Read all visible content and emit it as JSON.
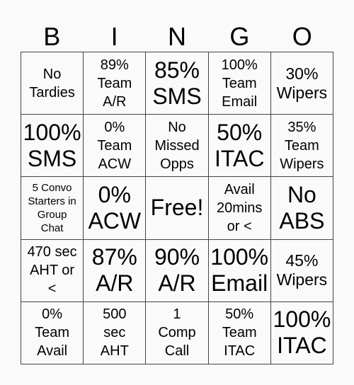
{
  "header": [
    "B",
    "I",
    "N",
    "G",
    "O"
  ],
  "cells": [
    {
      "text": "No\nTardies",
      "size": "m"
    },
    {
      "text": "89%\nTeam\nA/R",
      "size": "m"
    },
    {
      "text": "85%\nSMS",
      "size": "xl"
    },
    {
      "text": "100%\nTeam\nEmail",
      "size": "m"
    },
    {
      "text": "30%\nWipers",
      "size": "l"
    },
    {
      "text": "100%\nSMS",
      "size": "xl"
    },
    {
      "text": "0%\nTeam\nACW",
      "size": "m"
    },
    {
      "text": "No\nMissed\nOpps",
      "size": "m"
    },
    {
      "text": "50%\nITAC",
      "size": "xl"
    },
    {
      "text": "35%\nTeam\nWipers",
      "size": "m"
    },
    {
      "text": "5 Convo\nStarters in\nGroup\nChat",
      "size": "s"
    },
    {
      "text": "0%\nACW",
      "size": "xl"
    },
    {
      "text": "Free!",
      "size": "xl"
    },
    {
      "text": "Avail\n20mins\nor <",
      "size": "m"
    },
    {
      "text": "No\nABS",
      "size": "xl"
    },
    {
      "text": "470 sec\nAHT or\n<",
      "size": "m"
    },
    {
      "text": "87%\nA/R",
      "size": "xl"
    },
    {
      "text": "90%\nA/R",
      "size": "xl"
    },
    {
      "text": "100%\nEmail",
      "size": "xl"
    },
    {
      "text": "45%\nWipers",
      "size": "l"
    },
    {
      "text": "0%\nTeam\nAvail",
      "size": "m"
    },
    {
      "text": "500\nsec\nAHT",
      "size": "m"
    },
    {
      "text": "1\nComp\nCall",
      "size": "m"
    },
    {
      "text": "50%\nTeam\nITAC",
      "size": "m"
    },
    {
      "text": "100%\nITAC",
      "size": "xl"
    }
  ]
}
